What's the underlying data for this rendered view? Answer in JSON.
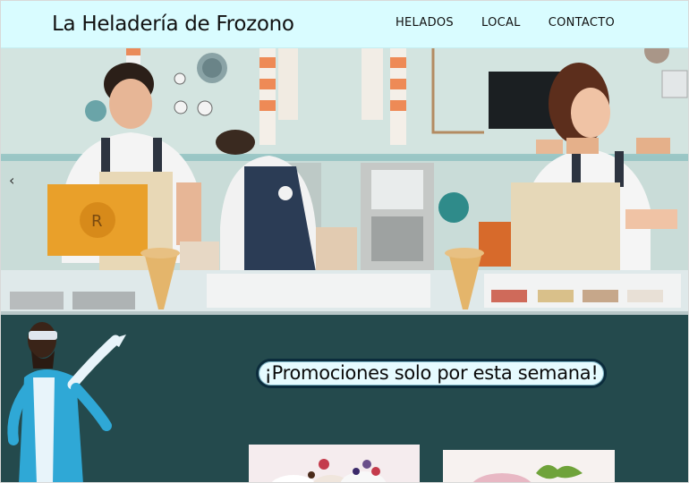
{
  "header": {
    "brand": "La Heladería de Frozono",
    "nav": [
      "HELADOS",
      "LOCAL",
      "CONTACTO"
    ]
  },
  "hero": {
    "prev_arrow": "‹",
    "image_subject": "ice-cream-shop-counter"
  },
  "promo": {
    "title": "¡Promociones solo por esta semana!"
  },
  "colors": {
    "header_bg": "#d9fcff",
    "promo_bg": "#244a4d",
    "promo_title_bg": "#e6fbff",
    "promo_title_border": "#0b2c3c"
  }
}
